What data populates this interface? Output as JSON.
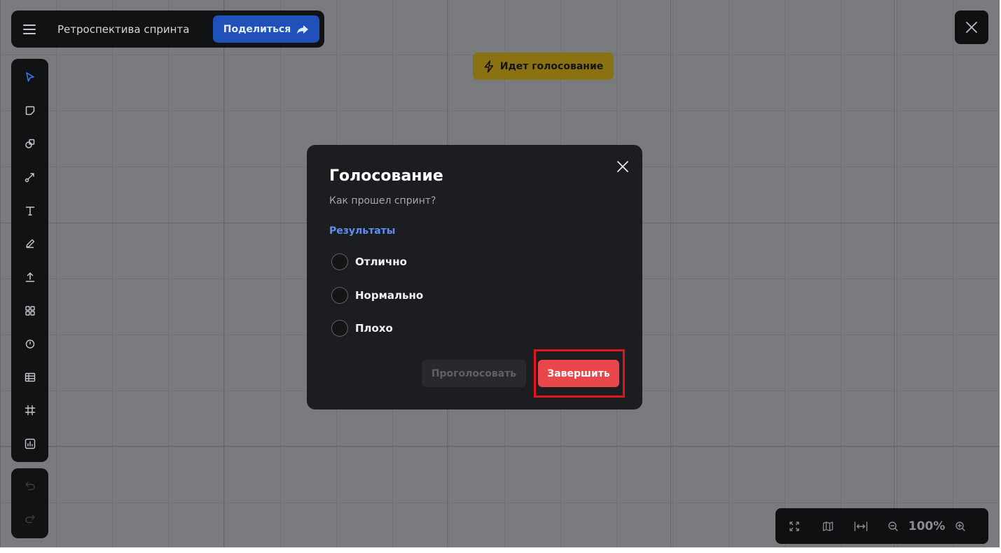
{
  "header": {
    "title": "Ретроспектива спринта",
    "share_label": "Поделиться"
  },
  "status_badge": {
    "label": "Идет голосование"
  },
  "toolbar": {
    "tools": [
      "select-icon",
      "sticky-note-icon",
      "shapes-icon",
      "connector-icon",
      "text-icon",
      "pen-icon",
      "upload-icon",
      "templates-icon",
      "timer-icon",
      "table-icon",
      "frame-icon",
      "chart-icon"
    ],
    "history": [
      "undo-icon",
      "redo-icon"
    ]
  },
  "zoom": {
    "value": "100%",
    "icons": [
      "fit-screen-icon",
      "minimap-icon",
      "fit-width-icon",
      "zoom-out-icon",
      "zoom-in-icon"
    ]
  },
  "modal": {
    "title": "Голосование",
    "question": "Как прошел спринт?",
    "results_link": "Результаты",
    "options": [
      "Отлично",
      "Нормально",
      "Плохо"
    ],
    "vote_button": "Проголосовать",
    "finish_button": "Завершить"
  },
  "colors": {
    "accent": "#1f51b8",
    "danger": "#e9474c",
    "badge": "#8a7112",
    "link": "#5e8ff2",
    "highlight": "#e3151c"
  }
}
